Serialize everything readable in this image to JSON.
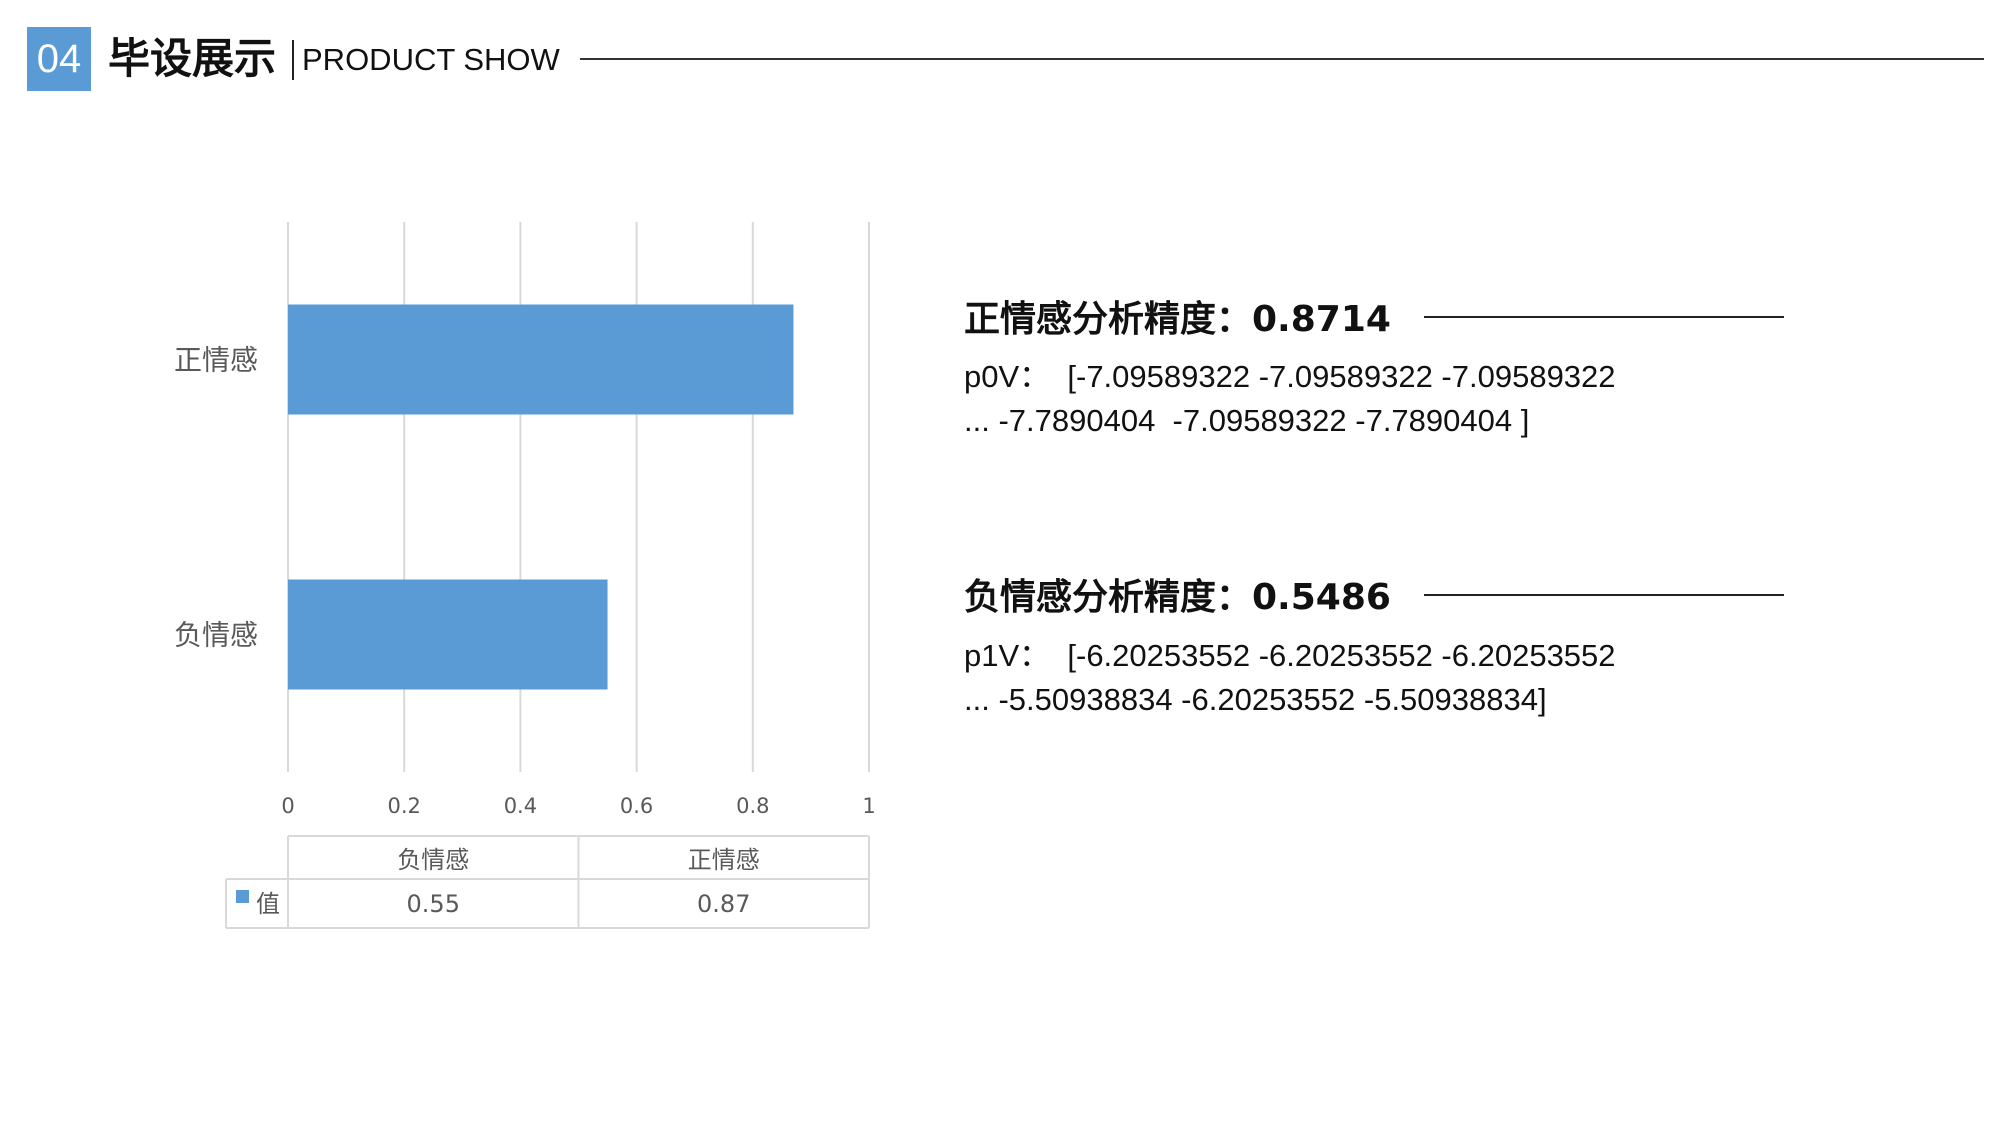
{
  "header": {
    "badge": "04",
    "title": "毕设展示",
    "subtitle": "PRODUCT SHOW"
  },
  "chart_data": {
    "type": "bar",
    "orientation": "horizontal",
    "categories": [
      "正情感",
      "负情感"
    ],
    "series": [
      {
        "name": "值",
        "values": [
          0.87,
          0.55
        ]
      }
    ],
    "xlim": [
      0,
      1
    ],
    "x_ticks": [
      "0",
      "0.2",
      "0.4",
      "0.6",
      "0.8",
      "1"
    ],
    "grid": true,
    "bar_color": "#5b9bd5",
    "data_table": {
      "columns": [
        "负情感",
        "正情感"
      ],
      "rows": [
        {
          "label": "值",
          "values": [
            "0.55",
            "0.87"
          ]
        }
      ]
    }
  },
  "results": {
    "positive": {
      "heading": "正情感分析精度：0.8714",
      "vector_line1": "p0V：  [-7.09589322 -7.09589322 -7.09589322",
      "vector_line2": "... -7.7890404  -7.09589322 -7.7890404 ]"
    },
    "negative": {
      "heading": "负情感分析精度：0.5486",
      "vector_line1": "p1V：  [-6.20253552 -6.20253552 -6.20253552",
      "vector_line2": "... -5.50938834 -6.20253552 -5.50938834]"
    }
  },
  "colors": {
    "accent": "#5b9bd5",
    "grid": "#d9d9d9",
    "axis_text": "#595959"
  }
}
